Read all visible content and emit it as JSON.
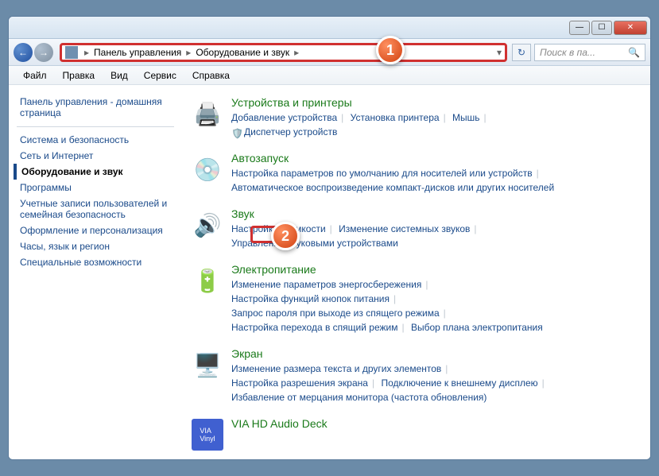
{
  "titlebar": {
    "min": "—",
    "max": "☐",
    "close": "✕"
  },
  "nav": {
    "back": "←",
    "fwd": "→",
    "refresh": "↻"
  },
  "breadcrumb": {
    "root": "Панель управления",
    "sub": "Оборудование и звук"
  },
  "search": {
    "placeholder": "Поиск в па...",
    "icon": "🔍"
  },
  "menu": {
    "file": "Файл",
    "edit": "Правка",
    "view": "Вид",
    "tools": "Сервис",
    "help": "Справка"
  },
  "sidebar": {
    "home": "Панель управления - домашняя страница",
    "items": [
      "Система и безопасность",
      "Сеть и Интернет",
      "Оборудование и звук",
      "Программы",
      "Учетные записи пользователей и семейная безопасность",
      "Оформление и персонализация",
      "Часы, язык и регион",
      "Специальные возможности"
    ]
  },
  "categories": {
    "devices": {
      "title": "Устройства и принтеры",
      "l1": "Добавление устройства",
      "l2": "Установка принтера",
      "l3": "Мышь",
      "l4": "Диспетчер устройств"
    },
    "autoplay": {
      "title": "Автозапуск",
      "l1": "Настройка параметров по умолчанию для носителей или устройств",
      "l2": "Автоматическое воспроизведение компакт-дисков или других носителей"
    },
    "sound": {
      "title": "Звук",
      "l1": "Настройка громкости",
      "l2": "Изменение системных звуков",
      "l3": "Управление звуковыми устройствами"
    },
    "power": {
      "title": "Электропитание",
      "l1": "Изменение параметров энергосбережения",
      "l2": "Настройка функций кнопок питания",
      "l3": "Запрос пароля при выходе из спящего режима",
      "l4": "Настройка перехода в спящий режим",
      "l5": "Выбор плана электропитания"
    },
    "display": {
      "title": "Экран",
      "l1": "Изменение размера текста и других элементов",
      "l2": "Настройка разрешения экрана",
      "l3": "Подключение к внешнему дисплею",
      "l4": "Избавление от мерцания монитора (частота обновления)"
    },
    "via": {
      "title": "VIA HD Audio Deck"
    }
  },
  "callouts": {
    "c1": "1",
    "c2": "2"
  }
}
